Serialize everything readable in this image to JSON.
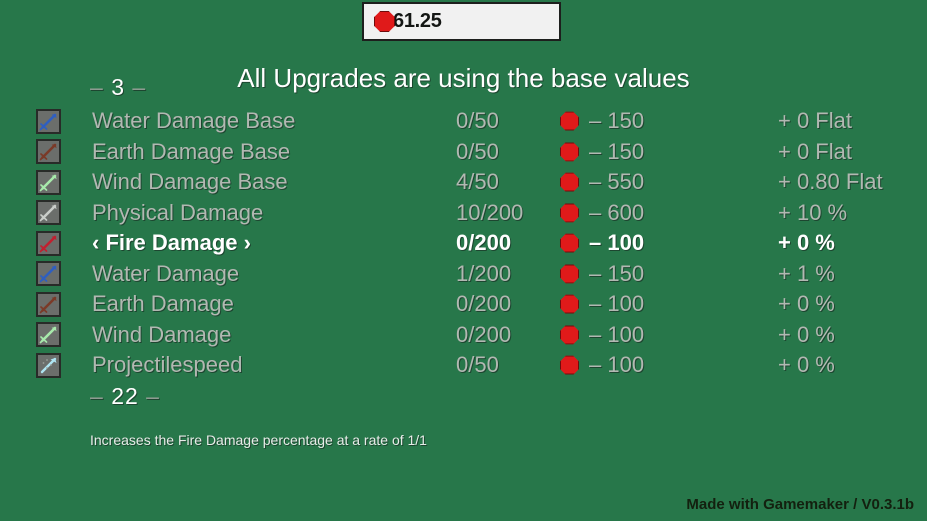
{
  "colors": {
    "background": "#27774a",
    "label_dim": "#b2b8b2",
    "label_selected": "#ffffff",
    "cost_chip": "#e01a1a",
    "box_fill": "#f1f1f1",
    "box_border": "#1d1f1d",
    "footer_text": "#13200f"
  },
  "value_box": {
    "icon": "red-octagon-currency-icon",
    "value": "61.25"
  },
  "header": {
    "counter_prefix": "–",
    "counter_value": "3",
    "counter_suffix": "–",
    "title": "All Upgrades are using the base values"
  },
  "upgrades": [
    {
      "icon": "water-sword-icon",
      "icon_color": "#2f5fc0",
      "label": "Water Damage Base",
      "count": "0/50",
      "cost": "– 150",
      "bonus": "+ 0 Flat",
      "selected": false
    },
    {
      "icon": "earth-sword-icon",
      "icon_color": "#7a3a28",
      "label": "Earth Damage Base",
      "count": "0/50",
      "cost": "– 150",
      "bonus": "+ 0 Flat",
      "selected": false
    },
    {
      "icon": "wind-sword-icon",
      "icon_color": "#a7e9ab",
      "label": "Wind Damage Base",
      "count": "4/50",
      "cost": "– 550",
      "bonus": "+ 0.80 Flat",
      "selected": false
    },
    {
      "icon": "physical-sword-icon",
      "icon_color": "#c9cdc9",
      "label": "Physical Damage",
      "count": "10/200",
      "cost": "– 600",
      "bonus": "+ 10 %",
      "selected": false
    },
    {
      "icon": "fire-sword-icon",
      "icon_color": "#c02030",
      "label": "‹ Fire Damage ›",
      "count": "0/200",
      "cost": "– 100",
      "bonus": "+ 0 %",
      "selected": true
    },
    {
      "icon": "water-sword-icon",
      "icon_color": "#2f5fc0",
      "label": "Water Damage",
      "count": "1/200",
      "cost": "– 150",
      "bonus": "+ 1 %",
      "selected": false
    },
    {
      "icon": "earth-sword-icon",
      "icon_color": "#7a3a28",
      "label": "Earth Damage",
      "count": "0/200",
      "cost": "– 100",
      "bonus": "+ 0 %",
      "selected": false
    },
    {
      "icon": "wind-sword-icon",
      "icon_color": "#a7e9ab",
      "label": "Wind Damage",
      "count": "0/200",
      "cost": "– 100",
      "bonus": "+ 0 %",
      "selected": false
    },
    {
      "icon": "projectile-arrow-icon",
      "icon_color": "#aee4f2",
      "label": "Projectilespeed",
      "count": "0/50",
      "cost": "– 100",
      "bonus": "+ 0 %",
      "selected": false
    }
  ],
  "footer_section": {
    "counter_prefix": "–",
    "counter_value": "22",
    "counter_suffix": "–",
    "description": "Increases the Fire Damage percentage at a rate of 1/1",
    "credit": "Made with Gamemaker / V0.3.1b"
  }
}
